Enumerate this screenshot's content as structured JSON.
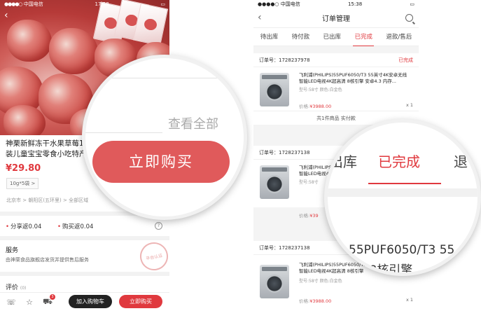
{
  "left": {
    "status_bar": {
      "carrier": "中国电信",
      "time": "17:58"
    },
    "product": {
      "title_line1": "神栗新鲜冻干水果草莓1",
      "title_line2": "装儿童宝宝零食小吃特产",
      "price": "¥29.80",
      "spec": "10g*5袋 >",
      "region": "北京市 > 朝阳区(五环里) > 全部区域"
    },
    "rebates": {
      "share": "分享返0.04",
      "buy": "购买返0.04",
      "help": "?"
    },
    "service": {
      "title": "服务",
      "desc": "由神栗食品旗舰店发货并提供售后服务",
      "stamp": "平台认证"
    },
    "review": {
      "title": "评价",
      "count": "(0)"
    },
    "bottom_bar": {
      "cart_badge": "3",
      "add_cart": "加入购物车",
      "buy_now": "立即购买"
    },
    "magnifier": {
      "see_all": "查看全部",
      "buy_now": "立即购买"
    }
  },
  "right": {
    "status_bar": {
      "carrier": "中国电信",
      "time": "15:38"
    },
    "header": {
      "title": "订单管理"
    },
    "tabs": [
      "待出库",
      "待付款",
      "已出库",
      "已完成",
      "退款/售后"
    ],
    "orders": [
      {
        "number": "订单号：1728237978",
        "status": "已完成",
        "name": "飞利浦(PHILIPS)55PUF6050/T3 55英寸4K安卓无线智能LED电视4K超高清 8核引擎 安卓4.3 内存...",
        "meta": "型号:58寸    颜色:白金色",
        "price_label": "价格:",
        "price": "¥3988.00",
        "qty": "x 1",
        "footer": "共1件商品  实付款"
      },
      {
        "number": "订单号：1728237138",
        "status": "",
        "name": "飞利浦(PHILIPS)55PUF6050/T3 55英寸4K安卓无线智能LED电视4K超高清 8核引擎",
        "meta": "型号:58寸",
        "price_label": "价格:",
        "price": "¥39",
        "qty": "",
        "footer": ""
      },
      {
        "number": "订单号：1728237138",
        "status": "",
        "name": "飞利浦(PHILIPS)55PUF6050/T3 55英寸4K安卓无线智能LED电视4K超高清 8核引擎",
        "meta": "型号:58寸    颜色:白金色",
        "price_label": "价格:",
        "price": "¥3988.00",
        "qty": "x 1",
        "footer": ""
      }
    ],
    "magnifier": {
      "tab_left": "出库",
      "tab_active": "已完成",
      "tab_right": "退",
      "model_line1": "55PUF6050/T3 55",
      "model_line2": "高清 8核引擎"
    }
  },
  "colors": {
    "accent": "#e0393e",
    "dark_button": "#222222"
  }
}
